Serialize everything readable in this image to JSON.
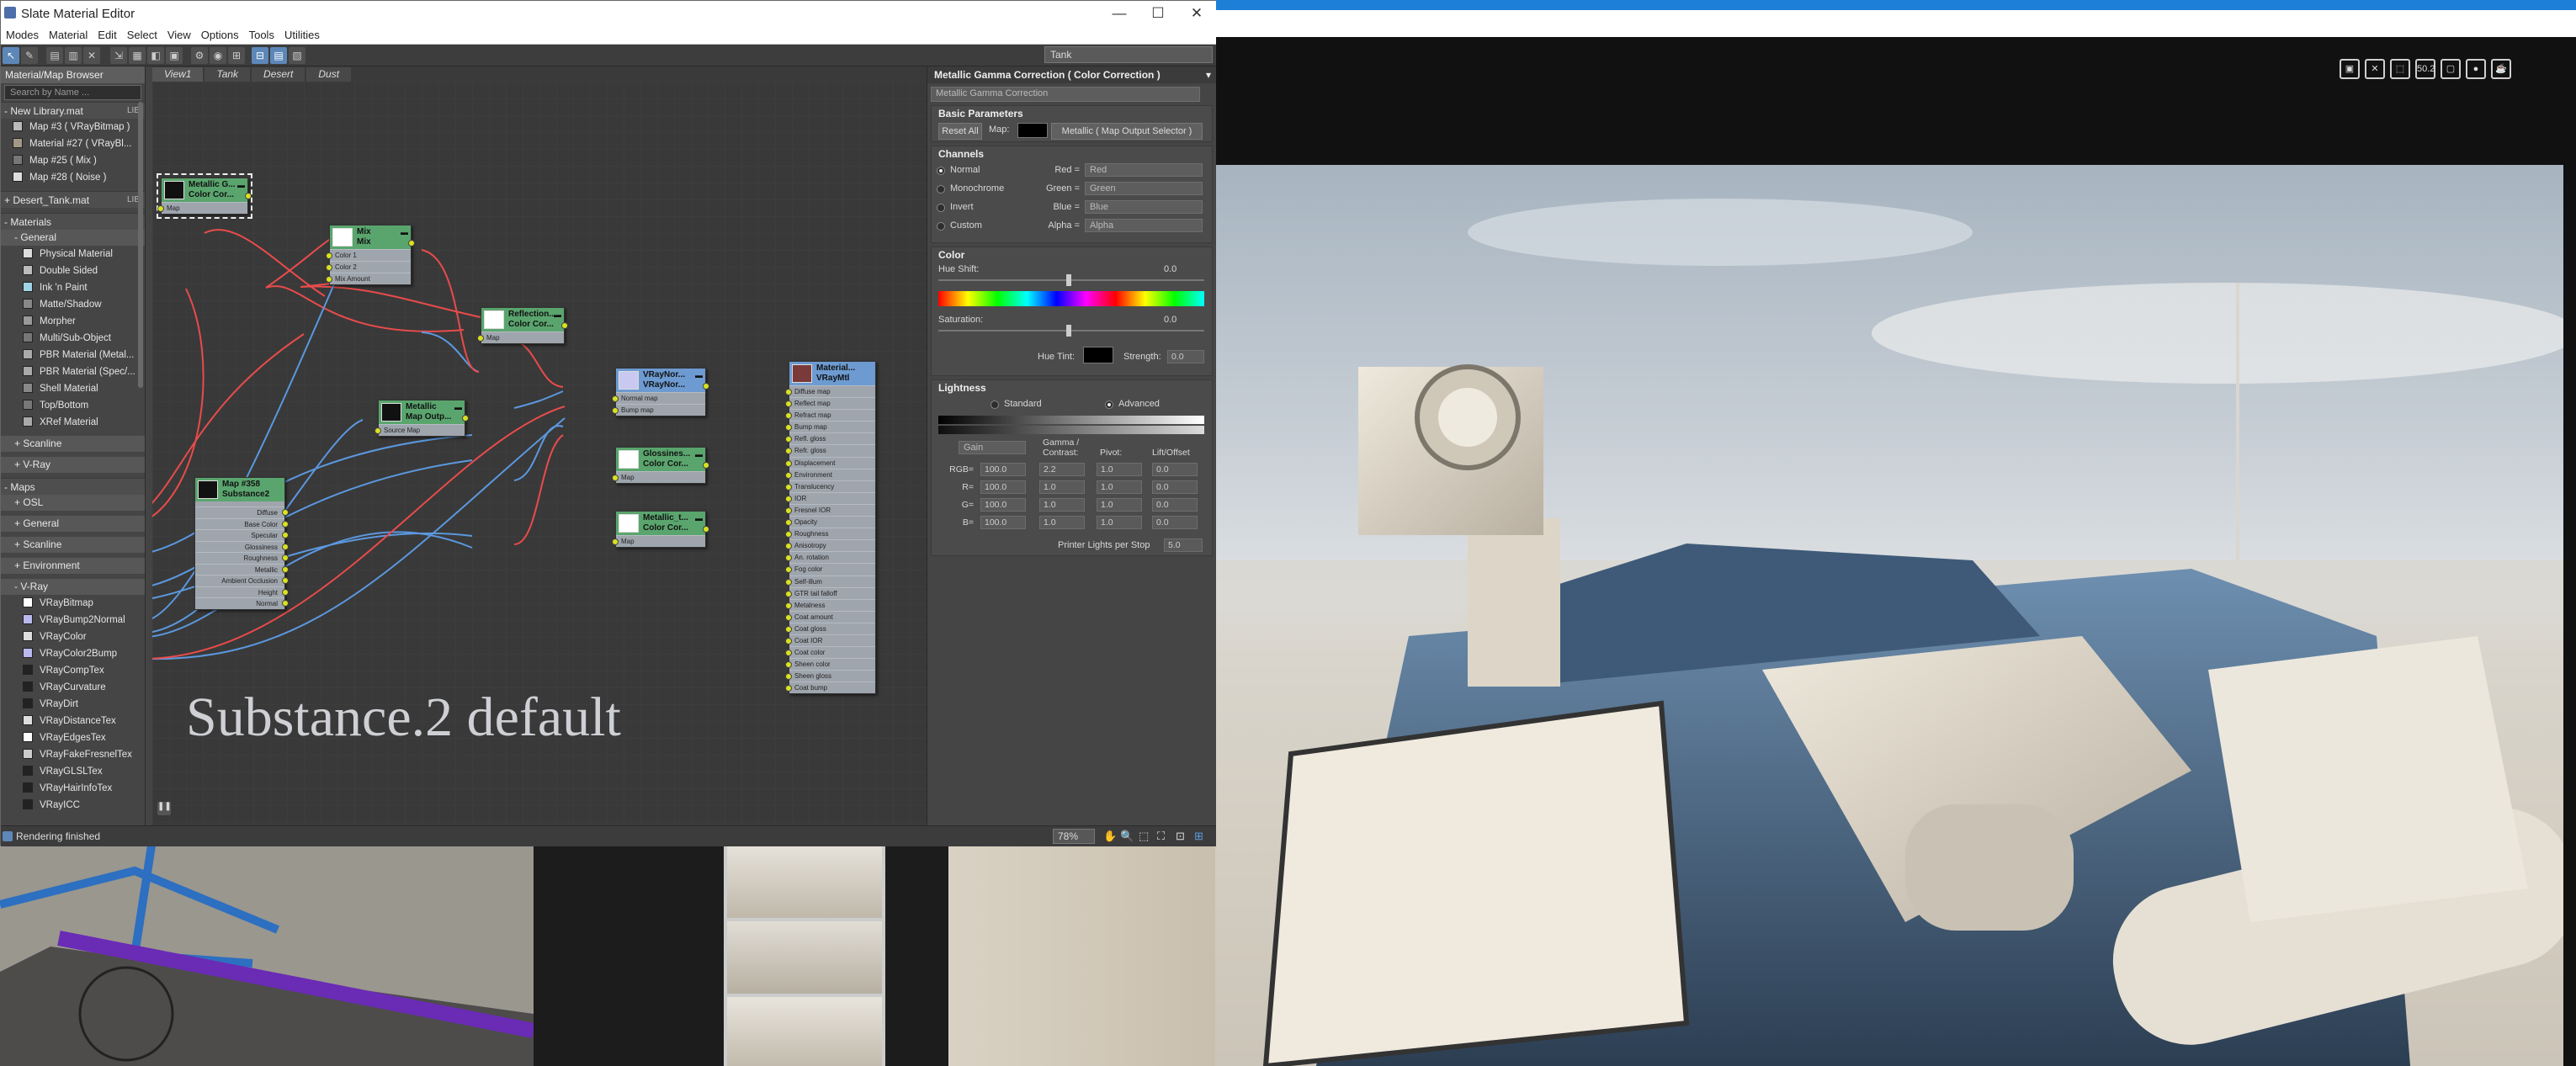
{
  "window": {
    "title": "Slate Material Editor",
    "minimize": "—",
    "maximize": "☐",
    "close": "✕"
  },
  "menu": [
    "Modes",
    "Material",
    "Edit",
    "Select",
    "View",
    "Options",
    "Tools",
    "Utilities"
  ],
  "toolbar": {
    "view_select": "Tank"
  },
  "browser": {
    "title": "Material/Map Browser",
    "search_placeholder": "Search by Name ...",
    "new_library": {
      "label": "- New Library.mat",
      "lib": "LIB",
      "items": [
        "Map #3 ( VRayBitmap )",
        "Material #27 ( VRayBl...",
        "Map #25 ( Mix )",
        "Map #28 ( Noise )"
      ]
    },
    "desert": {
      "label": "+ Desert_Tank.mat",
      "lib": "LIB"
    },
    "materials": {
      "label": "- Materials",
      "general": "- General",
      "items": [
        "Physical Material",
        "Double Sided",
        "Ink 'n Paint",
        "Matte/Shadow",
        "Morpher",
        "Multi/Sub-Object",
        "PBR Material (Metal...",
        "PBR Material (Spec/...",
        "Shell Material",
        "Top/Bottom",
        "XRef Material"
      ],
      "scanline": "+ Scanline",
      "vray": "+ V-Ray"
    },
    "maps": {
      "label": "- Maps",
      "osl": "+ OSL",
      "general": "+ General",
      "scanline": "+ Scanline",
      "environment": "+ Environment",
      "vray": "- V-Ray",
      "items": [
        "VRayBitmap",
        "VRayBump2Normal",
        "VRayColor",
        "VRayColor2Bump",
        "VRayCompTex",
        "VRayCurvature",
        "VRayDirt",
        "VRayDistanceTex",
        "VRayEdgesTex",
        "VRayFakeFresnelTex",
        "VRayGLSLTex",
        "VRayHairInfoTex",
        "VRayICC"
      ]
    }
  },
  "tabs": [
    "View1",
    "Tank",
    "Desert",
    "Dust"
  ],
  "nodes": {
    "metallic_gc": {
      "title1": "Metallic G...",
      "title2": "Color Cor...",
      "slots": [
        "Map"
      ]
    },
    "mix": {
      "title1": "Mix",
      "title2": "Mix",
      "slots": [
        "Color 1",
        "Color 2",
        "Mix Amount"
      ]
    },
    "reflection_cc": {
      "title1": "Reflection...",
      "title2": "Color Cor...",
      "slots": [
        "Map"
      ]
    },
    "metallic_out": {
      "title1": "Metallic",
      "title2": "Map Outp...",
      "slots": [
        "Source Map"
      ]
    },
    "vraynor": {
      "title1": "VRayNor...",
      "title2": "VRayNor...",
      "slots": [
        "Normal map",
        "Bump map"
      ]
    },
    "glossiness_cc": {
      "title1": "Glossines...",
      "title2": "Color Cor...",
      "slots": [
        "Map"
      ]
    },
    "metallic_cc": {
      "title1": "Metallic_t...",
      "title2": "Color Cor...",
      "slots": [
        "Map"
      ]
    },
    "substance": {
      "title1": "Map #358",
      "title2": "Substance2",
      "slots": [
        "Diffuse",
        "Base Color",
        "Specular",
        "Glossiness",
        "Roughness",
        "Metallic",
        "Ambient Occlusion",
        "Height",
        "Normal"
      ]
    },
    "vraymtl": {
      "title1": "Material...",
      "title2": "VRayMtl",
      "slots": [
        "Diffuse map",
        "Reflect map",
        "Refract map",
        "Bump map",
        "Refl. gloss",
        "Refr. gloss",
        "Displacement",
        "Environment",
        "Translucency",
        "IOR",
        "Fresnel IOR",
        "Opacity",
        "Roughness",
        "Anisotropy",
        "An. rotation",
        "Fog color",
        "Self-illum",
        "GTR tail falloff",
        "Metalness",
        "Coat amount",
        "Coat gloss",
        "Coat IOR",
        "Coat color",
        "Sheen color",
        "Sheen gloss",
        "Coat bump"
      ]
    }
  },
  "watermark": "Substance.2 default",
  "params": {
    "header": "Metallic Gamma Correction  ( Color Correction )",
    "name": "Metallic Gamma Correction",
    "basic": {
      "title": "Basic Parameters",
      "reset": "Reset All",
      "map_label": "Map:",
      "map_value": "Metallic  ( Map Output Selector )"
    },
    "channels": {
      "title": "Channels",
      "modes": [
        "Normal",
        "Monochrome",
        "Invert",
        "Custom"
      ],
      "rows": [
        {
          "label": "Red =",
          "value": "Red"
        },
        {
          "label": "Green =",
          "value": "Green"
        },
        {
          "label": "Blue =",
          "value": "Blue"
        },
        {
          "label": "Alpha =",
          "value": "Alpha"
        }
      ]
    },
    "color": {
      "title": "Color",
      "hue_shift": "Hue Shift:",
      "hue_value": "0.0",
      "saturation": "Saturation:",
      "sat_value": "0.0",
      "hue_tint": "Hue Tint:",
      "strength": "Strength:",
      "strength_value": "0.0"
    },
    "lightness": {
      "title": "Lightness",
      "standard": "Standard",
      "advanced": "Advanced",
      "gain": "Gain",
      "col_gamma": "Gamma / Contrast:",
      "col_pivot": "Pivot:",
      "col_lift": "Lift/Offset",
      "rows": [
        {
          "label": "RGB=",
          "v": "100.0",
          "g": "2.2",
          "p": "1.0",
          "l": "0.0"
        },
        {
          "label": "R=",
          "v": "100.0",
          "g": "1.0",
          "p": "1.0",
          "l": "0.0"
        },
        {
          "label": "G=",
          "v": "100.0",
          "g": "1.0",
          "p": "1.0",
          "l": "0.0"
        },
        {
          "label": "B=",
          "v": "100.0",
          "g": "1.0",
          "p": "1.0",
          "l": "0.0"
        }
      ],
      "printer": "Printer Lights per Stop",
      "printer_value": "5.0"
    }
  },
  "status": {
    "text": "Rendering finished",
    "zoom": "78%"
  },
  "viewport": {
    "readout": "50.2"
  }
}
